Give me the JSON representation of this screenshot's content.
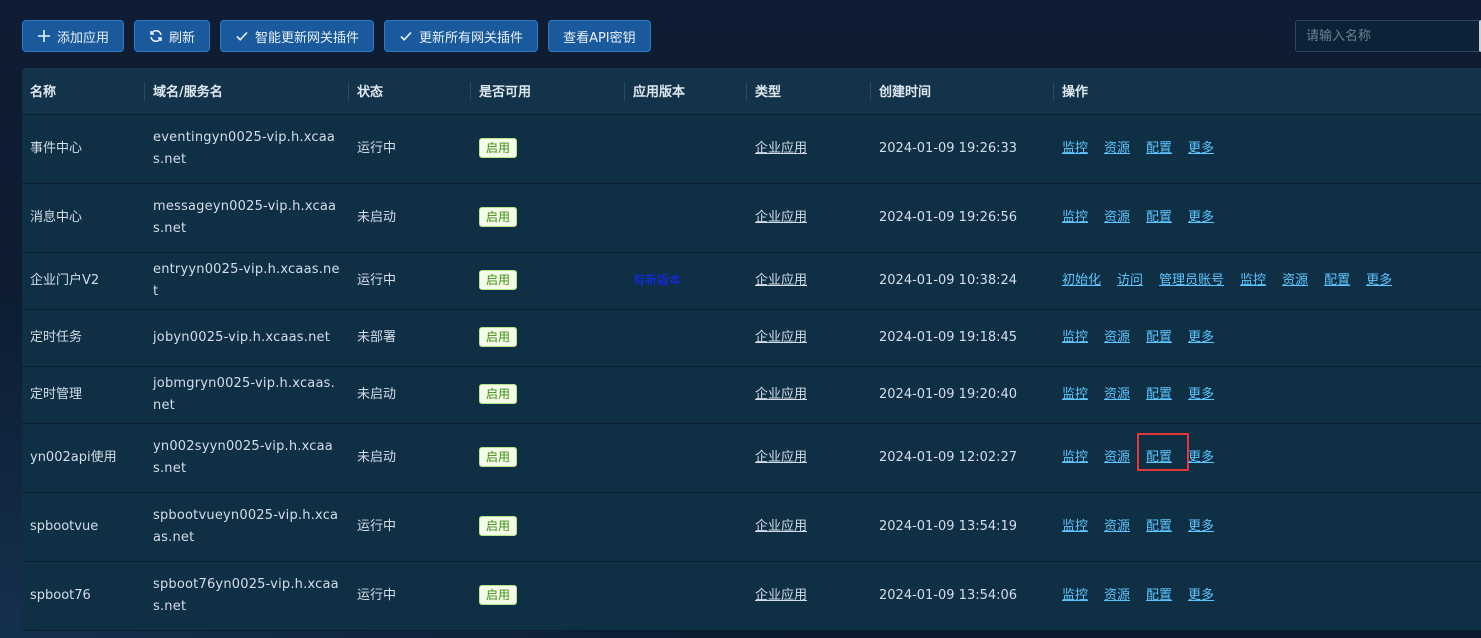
{
  "toolbar": {
    "add_app": "添加应用",
    "refresh": "刷新",
    "smart_update": "智能更新网关插件",
    "update_all": "更新所有网关插件",
    "view_api_key": "查看API密钥"
  },
  "search": {
    "placeholder": "请输入名称"
  },
  "columns": [
    "名称",
    "域名/服务名",
    "状态",
    "是否可用",
    "应用版本",
    "类型",
    "创建时间",
    "操作"
  ],
  "rows": [
    {
      "name": "事件中心",
      "domain": "eventingyn0025-vip.h.xcaas.net",
      "status": "运行中",
      "enabled": "启用",
      "version": "",
      "type": "企业应用",
      "created": "2024-01-09 19:26:33",
      "ops": [
        "监控",
        "资源",
        "配置",
        "更多"
      ]
    },
    {
      "name": "消息中心",
      "domain": "messageyn0025-vip.h.xcaas.net",
      "status": "未启动",
      "enabled": "启用",
      "version": "",
      "type": "企业应用",
      "created": "2024-01-09 19:26:56",
      "ops": [
        "监控",
        "资源",
        "配置",
        "更多"
      ]
    },
    {
      "name": "企业门户V2",
      "domain": "entryyn0025-vip.h.xcaas.net",
      "status": "运行中",
      "enabled": "启用",
      "version": "有新版本",
      "type": "企业应用",
      "created": "2024-01-09 10:38:24",
      "ops": [
        "初始化",
        "访问",
        "管理员账号",
        "监控",
        "资源",
        "配置",
        "更多"
      ]
    },
    {
      "name": "定时任务",
      "domain": "jobyn0025-vip.h.xcaas.net",
      "status": "未部署",
      "enabled": "启用",
      "version": "",
      "type": "企业应用",
      "created": "2024-01-09 19:18:45",
      "ops": [
        "监控",
        "资源",
        "配置",
        "更多"
      ]
    },
    {
      "name": "定时管理",
      "domain": "jobmgryn0025-vip.h.xcaas.net",
      "status": "未启动",
      "enabled": "启用",
      "version": "",
      "type": "企业应用",
      "created": "2024-01-09 19:20:40",
      "ops": [
        "监控",
        "资源",
        "配置",
        "更多"
      ]
    },
    {
      "name": "yn002api使用",
      "domain": "yn002syyn0025-vip.h.xcaas.net",
      "status": "未启动",
      "enabled": "启用",
      "version": "",
      "type": "企业应用",
      "created": "2024-01-09 12:02:27",
      "ops": [
        "监控",
        "资源",
        "配置",
        "更多"
      ]
    },
    {
      "name": "spbootvue",
      "domain": "spbootvueyn0025-vip.h.xcaas.net",
      "status": "运行中",
      "enabled": "启用",
      "version": "",
      "type": "企业应用",
      "created": "2024-01-09 13:54:19",
      "ops": [
        "监控",
        "资源",
        "配置",
        "更多"
      ]
    },
    {
      "name": "spboot76",
      "domain": "spboot76yn0025-vip.h.xcaas.net",
      "status": "运行中",
      "enabled": "启用",
      "version": "",
      "type": "企业应用",
      "created": "2024-01-09 13:54:06",
      "ops": [
        "监控",
        "资源",
        "配置",
        "更多"
      ]
    }
  ],
  "highlight": {
    "row": 5,
    "op": 2
  },
  "colors": {
    "accent": "#1a5a9c",
    "link": "#5ec6ff",
    "highlight_box": "#e3353a",
    "badge_text": "#3f8e17"
  }
}
